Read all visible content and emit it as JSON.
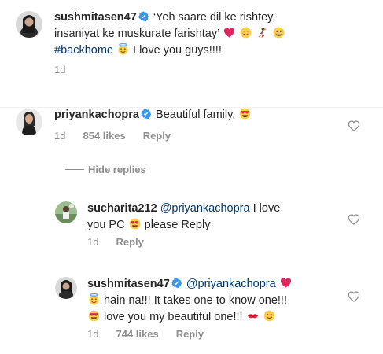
{
  "caption": {
    "username": "sushmitasen47",
    "text_line1": "‘Yeh saare dil ke rishtey,",
    "text_line2": "insaniyat ke muskurate farishtay’",
    "hashtag": "#backhome",
    "text_line3_rest": "I love you guys!!!!",
    "time": "1d"
  },
  "comments": [
    {
      "username": "priyankachopra",
      "text": "Beautiful family.",
      "time": "1d",
      "likes": "854 likes",
      "reply_label": "Reply"
    }
  ],
  "hide_replies_label": "Hide replies",
  "replies": [
    {
      "username": "sucharita212",
      "mention": "@priyankachopra",
      "text_line1": "I love",
      "text_line2_a": "you PC",
      "text_line2_b": "please Reply",
      "time": "1d",
      "reply_label": "Reply"
    },
    {
      "username": "sushmitasen47",
      "mention": "@priyankachopra",
      "text_line2": "hain na!!! It takes one to know one!!!",
      "text_line3": "love you my beautiful one!!!",
      "time": "1d",
      "likes": "744 likes",
      "reply_label": "Reply"
    }
  ],
  "colors": {
    "text": "#262626",
    "meta": "#8e8e8e",
    "link": "#00376b",
    "verified": "#3897f0"
  },
  "icons": [
    "verified-badge-icon",
    "heart-outline-icon",
    "red-heart-emoji",
    "smiling-face-emoji",
    "dancer-emoji",
    "grinning-emoji",
    "halo-emoji",
    "heart-eyes-emoji",
    "kiss-mark-emoji",
    "smile-emoji"
  ]
}
